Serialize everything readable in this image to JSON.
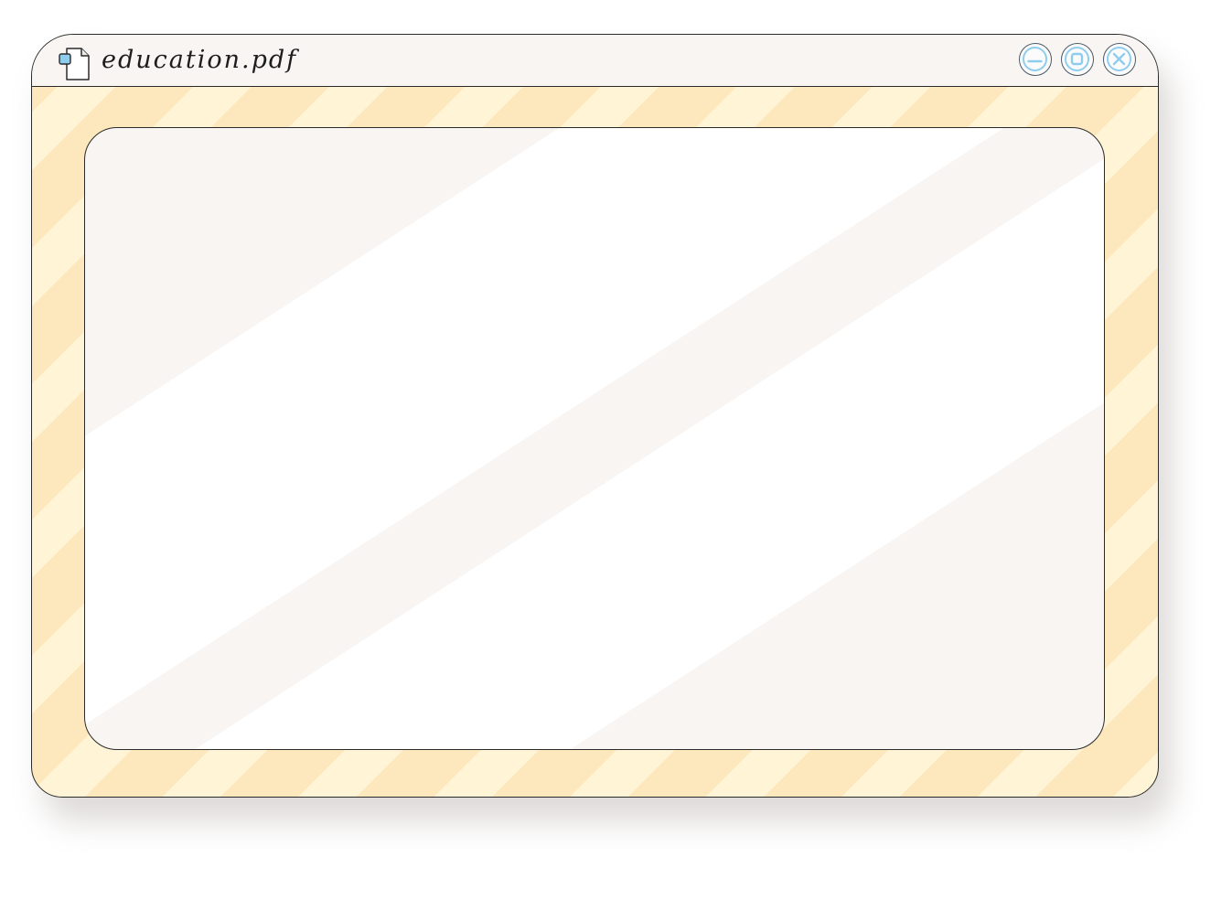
{
  "window": {
    "title": "education.pdf",
    "file_icon": "document-icon",
    "controls": [
      {
        "name": "minimize",
        "icon": "minimize-icon"
      },
      {
        "name": "maximize",
        "icon": "maximize-icon"
      },
      {
        "name": "close",
        "icon": "close-icon"
      }
    ]
  },
  "colors": {
    "stripe_dark": "#fde7bd",
    "stripe_light": "#fff5d6",
    "titlebar": "#f8f5f3",
    "control_accent": "#8fcdef",
    "outline": "#2a2a2a"
  }
}
